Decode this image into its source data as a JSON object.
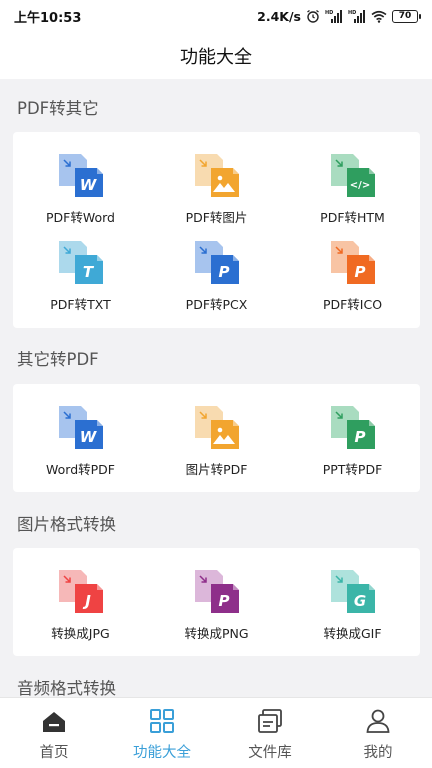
{
  "status_bar": {
    "time": "上午10:53",
    "speed": "2.4K/s",
    "battery": "70"
  },
  "title": "功能大全",
  "sections": [
    {
      "title": "PDF转其它",
      "tools": [
        {
          "label": "PDF转Word",
          "glyph": "W",
          "color": "#2b6fd1",
          "light": "#a7c4ee",
          "icon": "word-icon"
        },
        {
          "label": "PDF转图片",
          "glyph": "img",
          "color": "#f2a52f",
          "light": "#f8dbb0",
          "icon": "image-icon"
        },
        {
          "label": "PDF转HTM",
          "glyph": "</>",
          "color": "#2f9e5f",
          "light": "#a9dcc0",
          "icon": "html-icon"
        },
        {
          "label": "PDF转TXT",
          "glyph": "T",
          "color": "#3fa9d6",
          "light": "#acd9ec",
          "icon": "txt-icon"
        },
        {
          "label": "PDF转PCX",
          "glyph": "P",
          "color": "#2b6fd1",
          "light": "#a7c4ee",
          "icon": "pcx-icon"
        },
        {
          "label": "PDF转ICO",
          "glyph": "P",
          "color": "#f06a22",
          "light": "#f8c4a4",
          "icon": "ico-icon"
        }
      ]
    },
    {
      "title": "其它转PDF",
      "tools": [
        {
          "label": "Word转PDF",
          "glyph": "W",
          "color": "#2b6fd1",
          "light": "#a7c4ee",
          "icon": "word-icon"
        },
        {
          "label": "图片转PDF",
          "glyph": "img",
          "color": "#f2a52f",
          "light": "#f8dbb0",
          "icon": "image-icon"
        },
        {
          "label": "PPT转PDF",
          "glyph": "P",
          "color": "#2f9e5f",
          "light": "#a9dcc0",
          "icon": "ppt-icon"
        }
      ]
    },
    {
      "title": "图片格式转换",
      "tools": [
        {
          "label": "转换成JPG",
          "glyph": "J",
          "color": "#ef4343",
          "light": "#f6b8b8",
          "icon": "jpg-icon"
        },
        {
          "label": "转换成PNG",
          "glyph": "P",
          "color": "#8e2f8a",
          "light": "#dcb7da",
          "icon": "png-icon"
        },
        {
          "label": "转换成GIF",
          "glyph": "G",
          "color": "#3bb5a8",
          "light": "#aee2dc",
          "icon": "gif-icon"
        }
      ]
    },
    {
      "title": "音频格式转换",
      "tools": []
    }
  ],
  "bottom_nav": [
    {
      "label": "首页",
      "icon": "home-icon",
      "active": false
    },
    {
      "label": "功能大全",
      "icon": "grid-icon",
      "active": true
    },
    {
      "label": "文件库",
      "icon": "folder-icon",
      "active": false
    },
    {
      "label": "我的",
      "icon": "user-icon",
      "active": false
    }
  ],
  "colors": {
    "accent": "#3a9fd8",
    "background": "#f2f2f4"
  }
}
